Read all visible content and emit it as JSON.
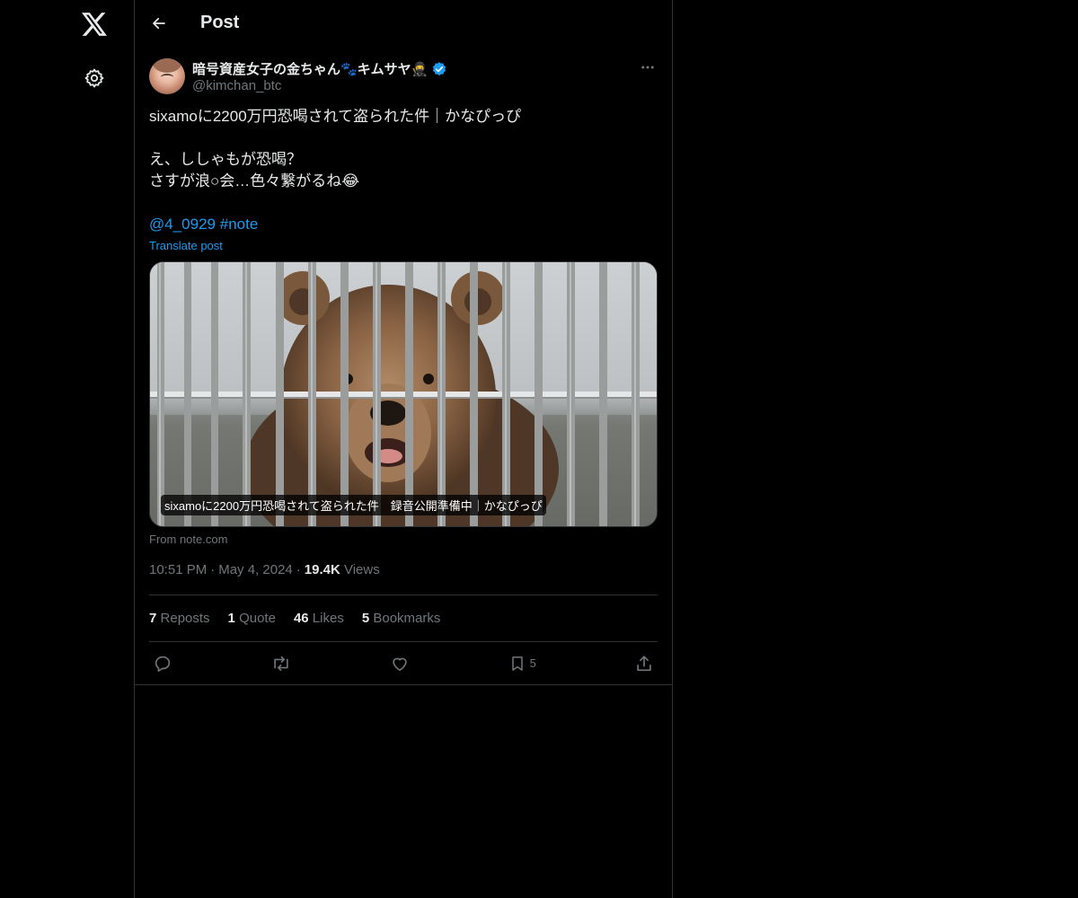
{
  "header": {
    "title": "Post"
  },
  "post": {
    "author": {
      "display_name": "暗号資産女子の金ちゃん🐾キムサヤ🥷",
      "handle": "@kimchan_btc"
    },
    "text_lines": [
      "sixamoに2200万円恐喝されて盗られた件｜かなぴっぴ",
      "",
      "え、ししゃもが恐喝？",
      "さすが浪○会…色々繋がるね😂",
      ""
    ],
    "mention": "@4_0929",
    "hashtag": "#note",
    "translate_label": "Translate post",
    "card": {
      "caption": "sixamoに2200万円恐喝されて盗られた件　録音公開準備中｜かなぴっぴ",
      "from": "From note.com"
    },
    "time": "10:51 PM",
    "date": "May 4, 2024",
    "views_count": "19.4K",
    "views_label": "Views",
    "stats": {
      "reposts_count": "7",
      "reposts_label": "Reposts",
      "quote_count": "1",
      "quote_label": "Quote",
      "likes_count": "46",
      "likes_label": "Likes",
      "bookmarks_count": "5",
      "bookmarks_label": "Bookmarks"
    },
    "actions": {
      "bookmark_count": "5"
    }
  },
  "icons": {
    "logo": "x-logo-icon",
    "settings": "gear-icon",
    "back": "arrow-left-icon",
    "more": "more-horizontal-icon",
    "verified": "verified-badge-icon",
    "reply": "reply-icon",
    "repost": "repost-icon",
    "like": "heart-icon",
    "bookmark": "bookmark-icon",
    "share": "share-icon"
  },
  "colors": {
    "accent": "#1d9bf0",
    "background": "#000000",
    "muted": "#71767b",
    "border": "#2f3336"
  }
}
